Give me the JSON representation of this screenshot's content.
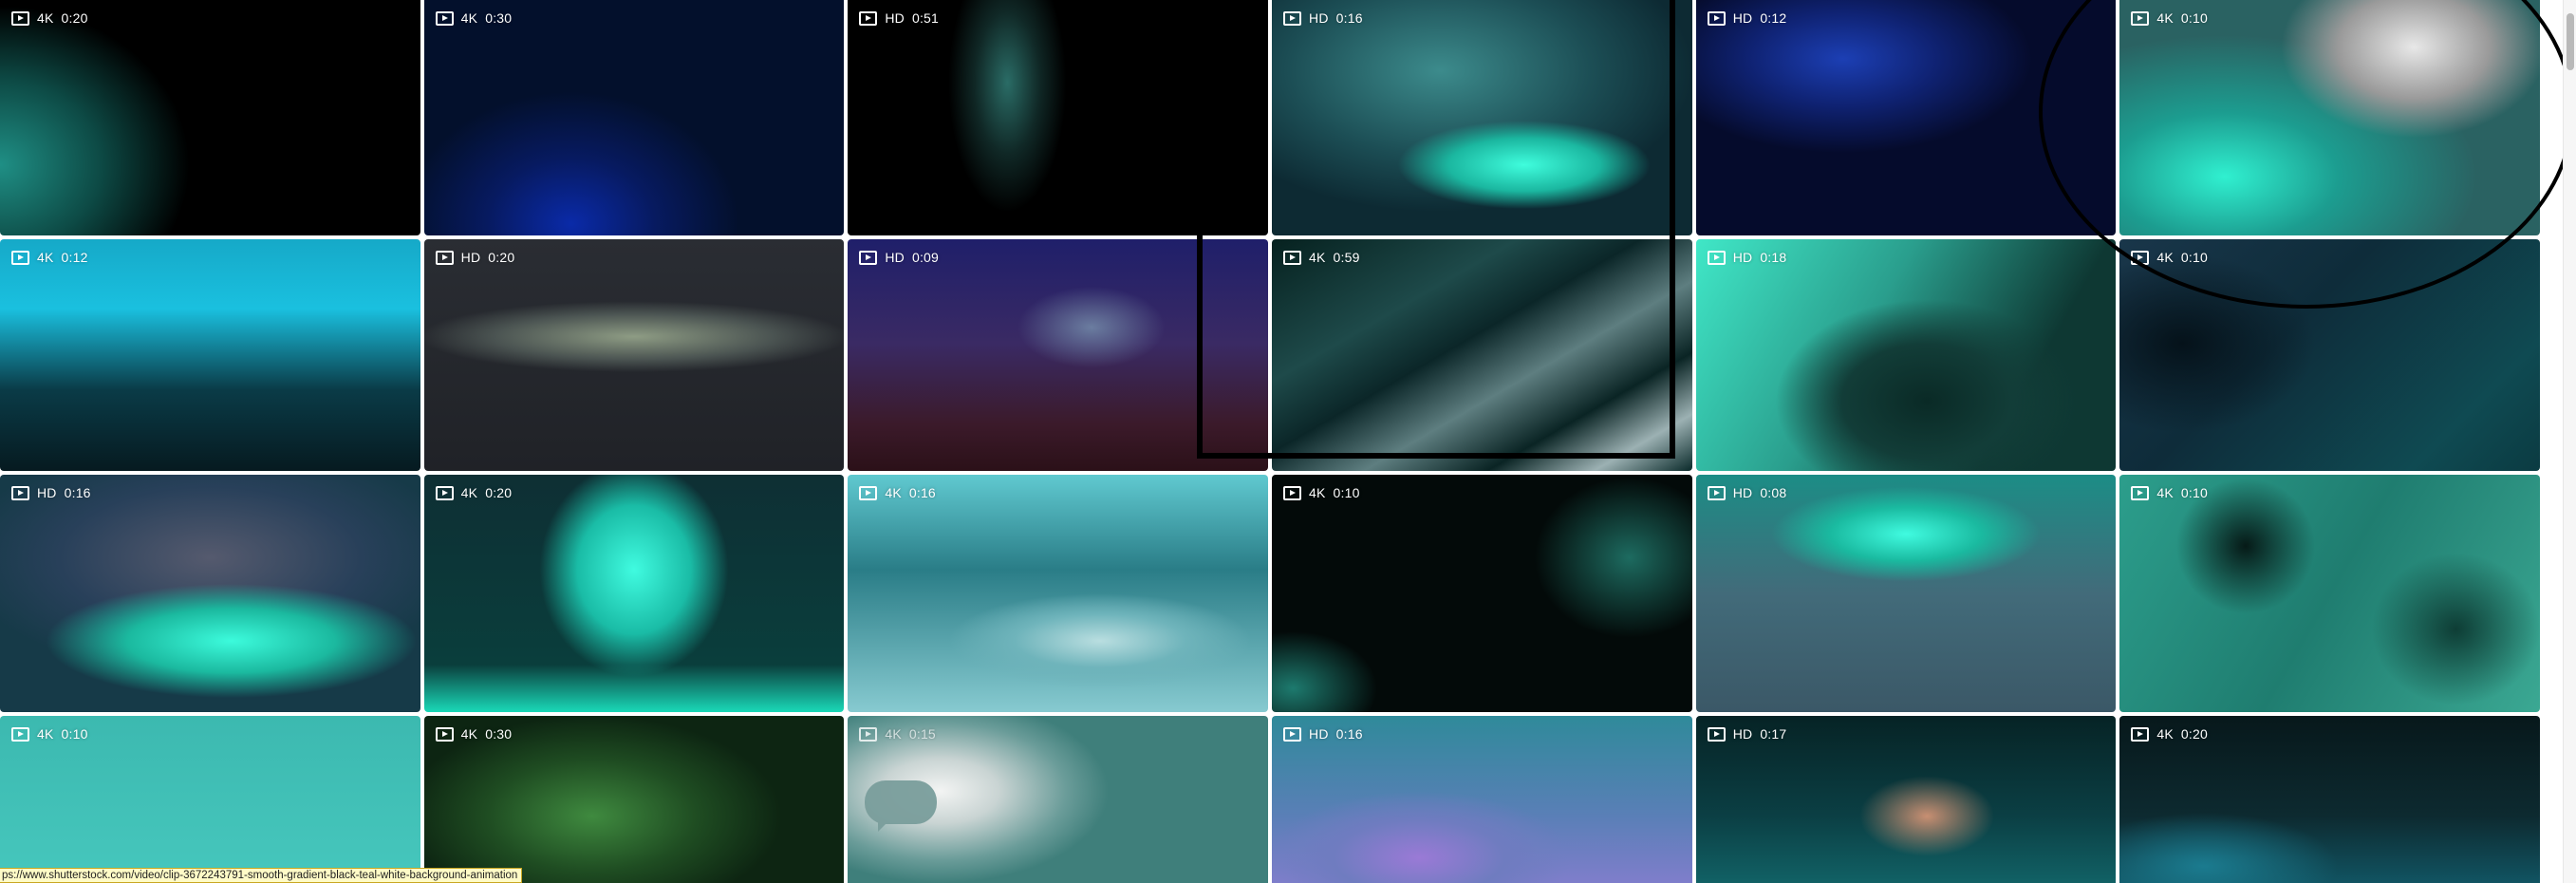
{
  "tiles": [
    {
      "quality": "4K",
      "duration": "0:20"
    },
    {
      "quality": "4K",
      "duration": "0:30"
    },
    {
      "quality": "HD",
      "duration": "0:51"
    },
    {
      "quality": "HD",
      "duration": "0:16"
    },
    {
      "quality": "HD",
      "duration": "0:12"
    },
    {
      "quality": "4K",
      "duration": "0:10"
    },
    {
      "quality": "4K",
      "duration": "0:12"
    },
    {
      "quality": "HD",
      "duration": "0:20"
    },
    {
      "quality": "HD",
      "duration": "0:09"
    },
    {
      "quality": "4K",
      "duration": "0:59"
    },
    {
      "quality": "HD",
      "duration": "0:18"
    },
    {
      "quality": "4K",
      "duration": "0:10"
    },
    {
      "quality": "HD",
      "duration": "0:16"
    },
    {
      "quality": "4K",
      "duration": "0:20"
    },
    {
      "quality": "4K",
      "duration": "0:16"
    },
    {
      "quality": "4K",
      "duration": "0:10"
    },
    {
      "quality": "HD",
      "duration": "0:08"
    },
    {
      "quality": "4K",
      "duration": "0:10"
    },
    {
      "quality": "4K",
      "duration": "0:10"
    },
    {
      "quality": "4K",
      "duration": "0:30"
    },
    {
      "quality": "4K",
      "duration": "0:15"
    },
    {
      "quality": "HD",
      "duration": "0:16"
    },
    {
      "quality": "HD",
      "duration": "0:17"
    },
    {
      "quality": "4K",
      "duration": "0:20"
    }
  ],
  "status_bar": {
    "url": "ps://www.shutterstock.com/video/clip-3672243791-smooth-gradient-black-teal-white-background-animation"
  },
  "icons": {
    "tile_badge": "play-icon",
    "tile_21_overlay": "chat-bubble-icon"
  },
  "colors": {
    "annotation_stroke": "#000000",
    "status_bar_bg": "#fffbc7"
  }
}
